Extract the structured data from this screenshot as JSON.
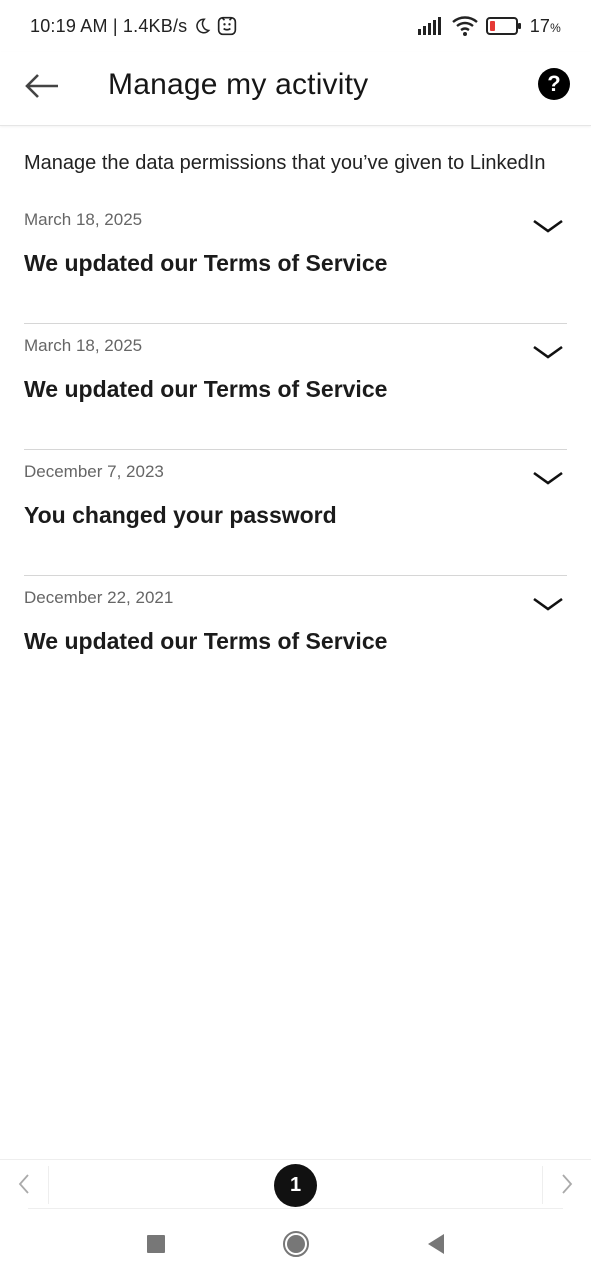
{
  "status_bar": {
    "time_speed": "10:19 AM | 1.4KB/s",
    "battery_percent": "17",
    "battery_unit": "%"
  },
  "app_bar": {
    "title": "Manage my activity",
    "help_label": "?"
  },
  "subtitle": "Manage the data permissions that you’ve given to LinkedIn",
  "activities": [
    {
      "date": "March 18, 2025",
      "title": "We updated our Terms of Service"
    },
    {
      "date": "March 18, 2025",
      "title": "We updated our Terms of Service"
    },
    {
      "date": "December 7, 2023",
      "title": "You changed your password"
    },
    {
      "date": "December 22, 2021",
      "title": "We updated our Terms of Service"
    }
  ],
  "pager": {
    "current_page": "1"
  },
  "colors": {
    "accent": "#000000",
    "battery_low": "#e53935",
    "divider": "#d6d6d6"
  },
  "icons": {
    "back": "arrow-left-icon",
    "help": "help-circle-icon",
    "chevron": "chevron-down-icon",
    "moon": "moon-icon",
    "face": "smile-badge-icon",
    "signal": "signal-icon",
    "wifi": "wifi-icon",
    "battery": "battery-icon"
  }
}
